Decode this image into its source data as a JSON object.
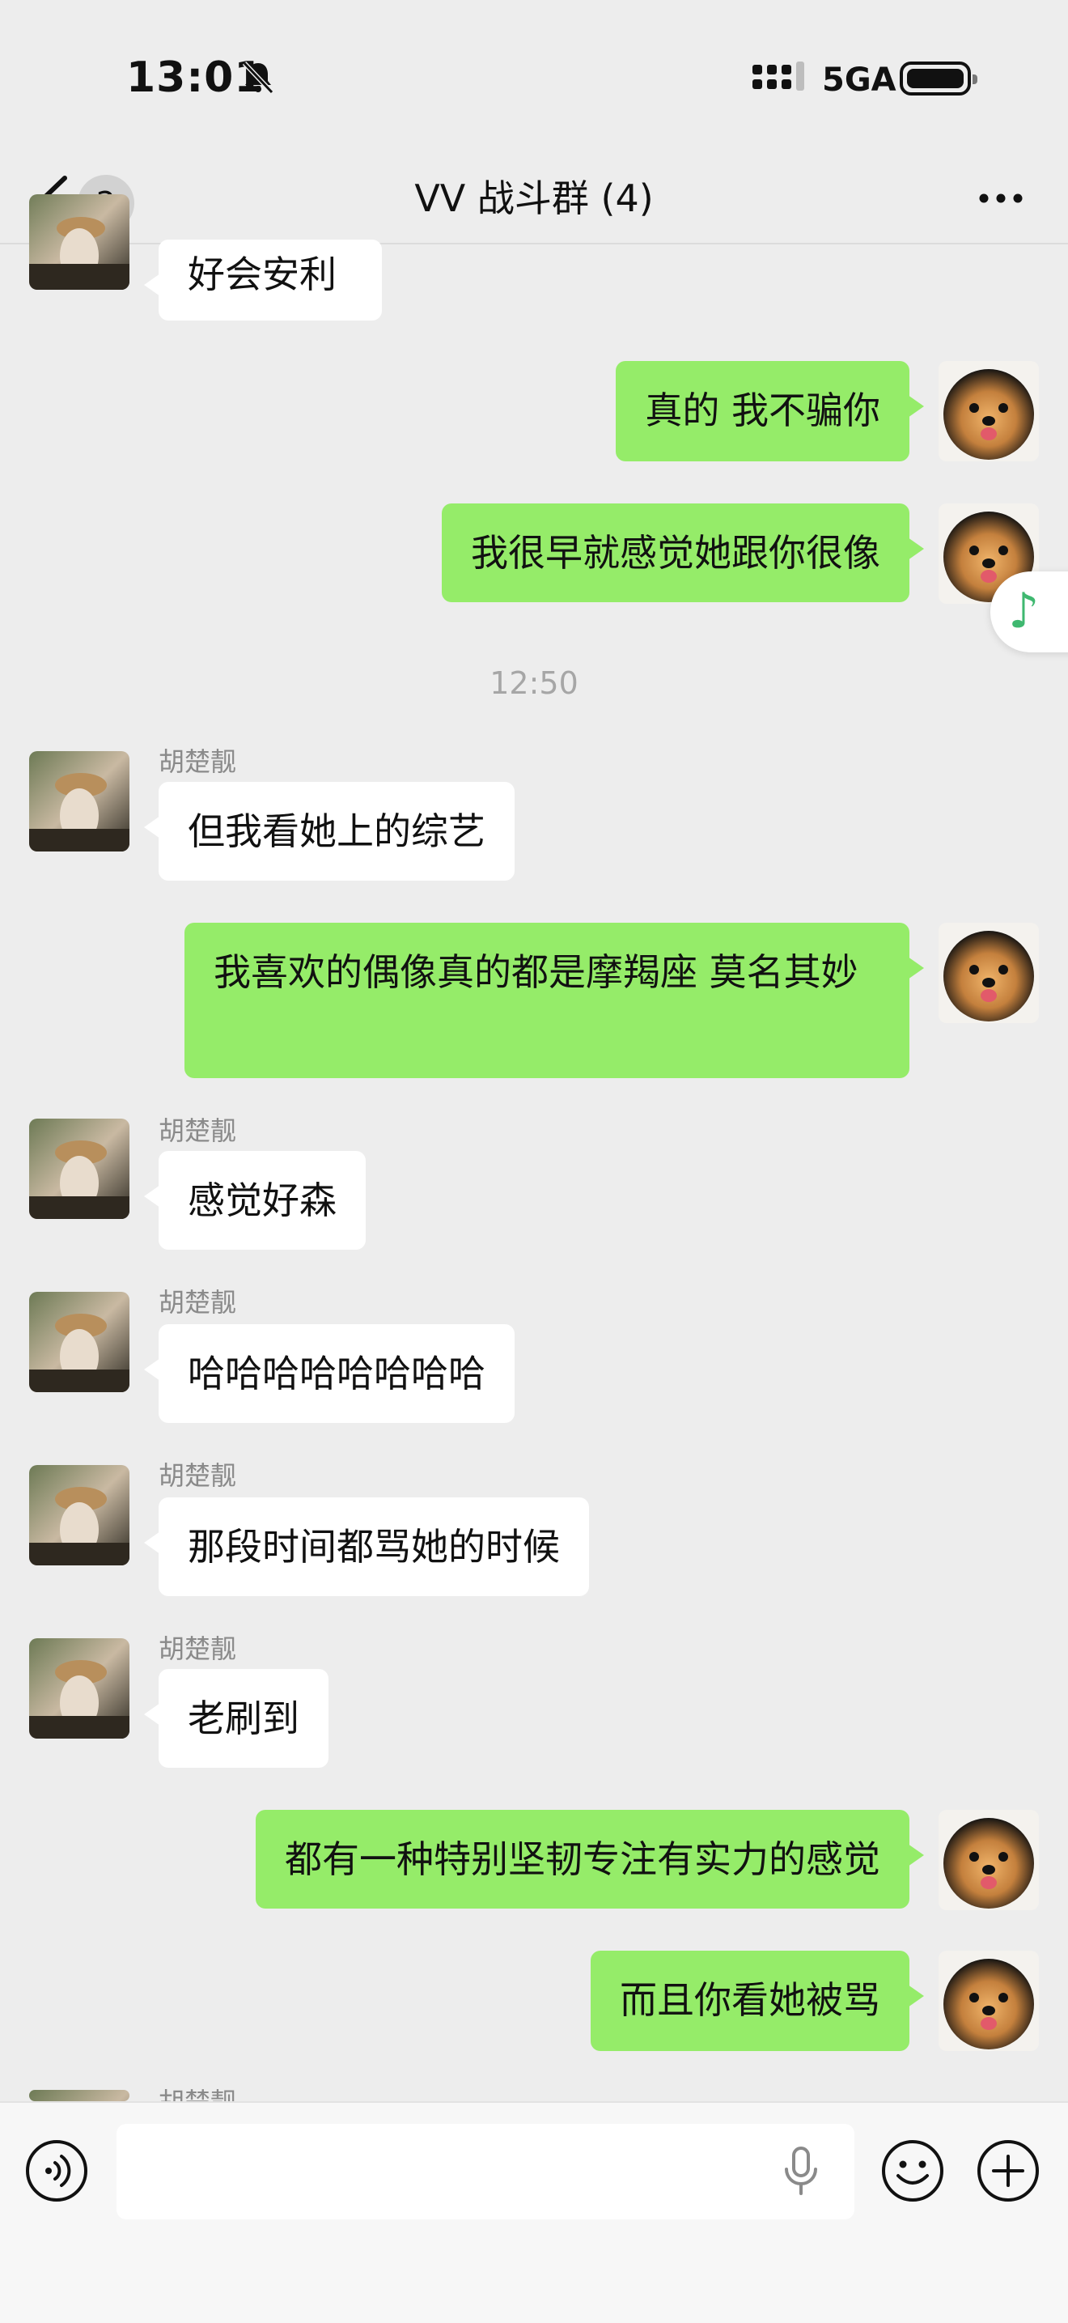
{
  "status_bar": {
    "time": "13:01",
    "network": "5GA"
  },
  "header": {
    "unread_badge": "2",
    "title": "VV 战斗群 (4)"
  },
  "messages": [
    {
      "text": "好会安利"
    },
    {
      "text": "真的 我不骗你"
    },
    {
      "text": "我很早就感觉她跟你很像"
    },
    {
      "timestamp": "12:50"
    },
    {
      "sender": "胡楚靓",
      "text": "但我看她上的综艺"
    },
    {
      "text": "我喜欢的偶像真的都是摩羯座 莫名其妙"
    },
    {
      "sender": "胡楚靓",
      "text": "感觉好森"
    },
    {
      "sender": "胡楚靓",
      "text": "哈哈哈哈哈哈哈哈"
    },
    {
      "sender": "胡楚靓",
      "text": "那段时间都骂她的时候"
    },
    {
      "sender": "胡楚靓",
      "text": "老刷到"
    },
    {
      "text": "都有一种特别坚韧专注有实力的感觉"
    },
    {
      "text": "而且你看她被骂"
    },
    {
      "sender": "胡楚靓"
    }
  ],
  "colors": {
    "background": "#ededed",
    "outgoing_bubble": "#95ec69",
    "incoming_bubble": "#ffffff",
    "music_note": "#3fb870"
  },
  "icons": [
    "back-chevron-icon",
    "more-icon",
    "music-note-icon",
    "voice-icon",
    "microphone-icon",
    "emoji-icon",
    "plus-icon",
    "mute-bell-icon",
    "signal-icon",
    "battery-icon"
  ]
}
